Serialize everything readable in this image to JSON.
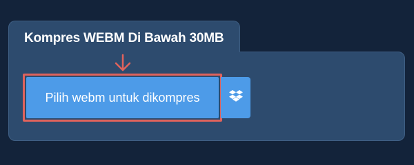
{
  "section": {
    "title": "Kompres WEBM Di Bawah 30MB"
  },
  "actions": {
    "choose_file_label": "Pilih webm untuk dikompres",
    "dropbox_icon": "dropbox-icon"
  },
  "colors": {
    "page_background": "#13233a",
    "panel_background": "#2d4b6e",
    "button_blue": "#4d9be8",
    "highlight_red": "#e0635c"
  }
}
